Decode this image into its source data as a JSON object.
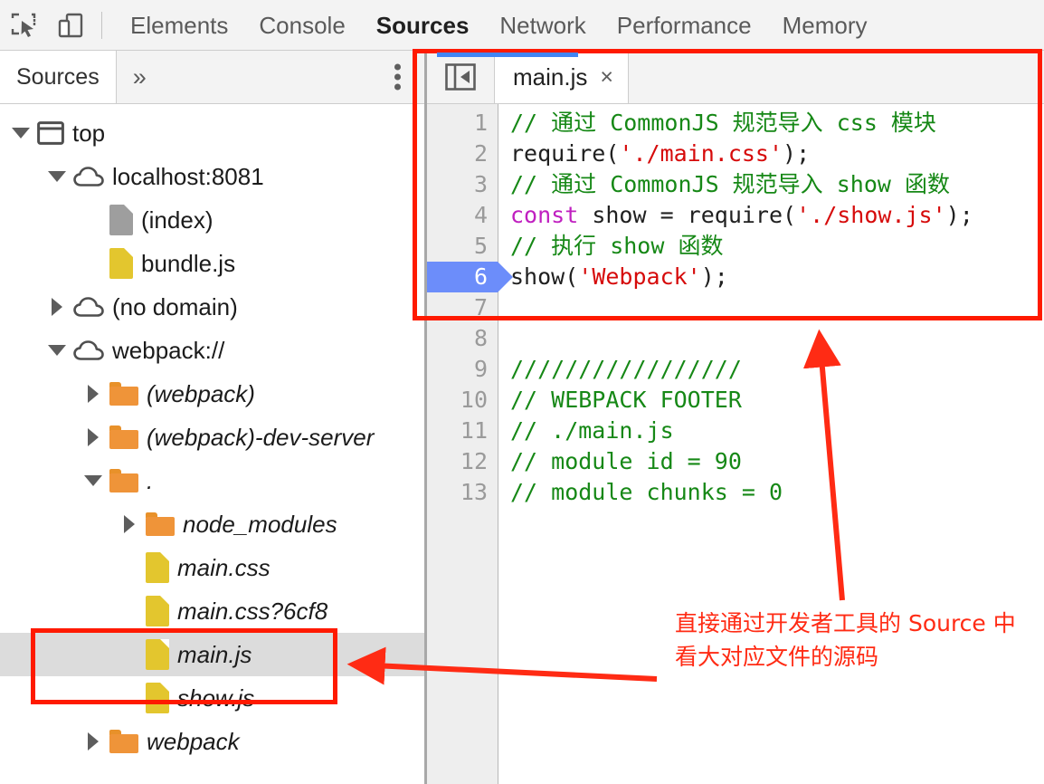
{
  "toolbar": {
    "inspect_icon": "inspect-element-icon",
    "device_icon": "device-toolbar-icon",
    "tabs": [
      {
        "label": "Elements",
        "active": false
      },
      {
        "label": "Console",
        "active": false
      },
      {
        "label": "Sources",
        "active": true
      },
      {
        "label": "Network",
        "active": false
      },
      {
        "label": "Performance",
        "active": false
      },
      {
        "label": "Memory",
        "active": false
      }
    ]
  },
  "navigator": {
    "tab_label": "Sources",
    "more_label": "»",
    "kebab_icon": "more-options-icon",
    "tree": [
      {
        "label": "top",
        "depth": 0,
        "twisty": "open",
        "icon": "frame",
        "italic": false,
        "selected": false
      },
      {
        "label": "localhost:8081",
        "depth": 1,
        "twisty": "open",
        "icon": "cloud",
        "italic": false,
        "selected": false
      },
      {
        "label": "(index)",
        "depth": 2,
        "twisty": "none",
        "icon": "doc-gray",
        "italic": false,
        "selected": false
      },
      {
        "label": "bundle.js",
        "depth": 2,
        "twisty": "none",
        "icon": "doc-yellow",
        "italic": false,
        "selected": false
      },
      {
        "label": "(no domain)",
        "depth": 1,
        "twisty": "closed",
        "icon": "cloud",
        "italic": false,
        "selected": false
      },
      {
        "label": "webpack://",
        "depth": 1,
        "twisty": "open",
        "icon": "cloud",
        "italic": false,
        "selected": false
      },
      {
        "label": "(webpack)",
        "depth": 2,
        "twisty": "closed",
        "icon": "folder",
        "italic": true,
        "selected": false
      },
      {
        "label": "(webpack)-dev-server",
        "depth": 2,
        "twisty": "closed",
        "icon": "folder",
        "italic": true,
        "selected": false
      },
      {
        "label": ".",
        "depth": 2,
        "twisty": "open",
        "icon": "folder",
        "italic": true,
        "selected": false
      },
      {
        "label": "node_modules",
        "depth": 3,
        "twisty": "closed",
        "icon": "folder",
        "italic": true,
        "selected": false
      },
      {
        "label": "main.css",
        "depth": 3,
        "twisty": "none",
        "icon": "doc-yellow",
        "italic": true,
        "selected": false
      },
      {
        "label": "main.css?6cf8",
        "depth": 3,
        "twisty": "none",
        "icon": "doc-yellow",
        "italic": true,
        "selected": false
      },
      {
        "label": "main.js",
        "depth": 3,
        "twisty": "none",
        "icon": "doc-yellow",
        "italic": true,
        "selected": true
      },
      {
        "label": "show.js",
        "depth": 3,
        "twisty": "none",
        "icon": "doc-yellow",
        "italic": true,
        "selected": false
      },
      {
        "label": "webpack",
        "depth": 2,
        "twisty": "closed",
        "icon": "folder",
        "italic": true,
        "selected": false
      }
    ]
  },
  "editor": {
    "sidebar_toggle_icon": "show-navigator-icon",
    "tab": {
      "name": "main.js",
      "close": "×"
    },
    "lines": [
      {
        "num": "1",
        "current": false,
        "tokens": [
          {
            "t": "comment",
            "v": "// 通过 CommonJS 规范导入 css 模块"
          }
        ]
      },
      {
        "num": "2",
        "current": false,
        "tokens": [
          {
            "t": "plain",
            "v": "require("
          },
          {
            "t": "string",
            "v": "'./main.css'"
          },
          {
            "t": "plain",
            "v": ");"
          }
        ]
      },
      {
        "num": "3",
        "current": false,
        "tokens": [
          {
            "t": "comment",
            "v": "// 通过 CommonJS 规范导入 show 函数"
          }
        ]
      },
      {
        "num": "4",
        "current": false,
        "tokens": [
          {
            "t": "kw",
            "v": "const"
          },
          {
            "t": "plain",
            "v": " show = require("
          },
          {
            "t": "string",
            "v": "'./show.js'"
          },
          {
            "t": "plain",
            "v": ");"
          }
        ]
      },
      {
        "num": "5",
        "current": false,
        "tokens": [
          {
            "t": "comment",
            "v": "// 执行 show 函数"
          }
        ]
      },
      {
        "num": "6",
        "current": true,
        "tokens": [
          {
            "t": "plain",
            "v": "show("
          },
          {
            "t": "string",
            "v": "'Webpack'"
          },
          {
            "t": "plain",
            "v": ");"
          }
        ]
      },
      {
        "num": "7",
        "current": false,
        "tokens": []
      },
      {
        "num": "8",
        "current": false,
        "tokens": []
      },
      {
        "num": "9",
        "current": false,
        "tokens": [
          {
            "t": "comment",
            "v": "/////////////////"
          }
        ]
      },
      {
        "num": "10",
        "current": false,
        "tokens": [
          {
            "t": "comment",
            "v": "// WEBPACK FOOTER"
          }
        ]
      },
      {
        "num": "11",
        "current": false,
        "tokens": [
          {
            "t": "comment",
            "v": "// ./main.js"
          }
        ]
      },
      {
        "num": "12",
        "current": false,
        "tokens": [
          {
            "t": "comment",
            "v": "// module id = 90"
          }
        ]
      },
      {
        "num": "13",
        "current": false,
        "tokens": [
          {
            "t": "comment",
            "v": "// module chunks = 0"
          }
        ]
      }
    ]
  },
  "annotation": {
    "line1": "直接通过开发者工具的 Source 中",
    "line2": "看大对应文件的源码",
    "color": "#ff2b14"
  },
  "colors": {
    "highlight_red": "#ff1a00",
    "active_tab_blue": "#4285f4",
    "selection_gray": "#dcdcdc",
    "comment_green": "#168816",
    "string_red": "#d60a0a",
    "keyword_magenta": "#c020c0",
    "folder_orange": "#ef9439",
    "js_file_yellow": "#e3c62e",
    "doc_gray": "#9e9e9e",
    "current_line_blue": "#6c8dfa"
  }
}
